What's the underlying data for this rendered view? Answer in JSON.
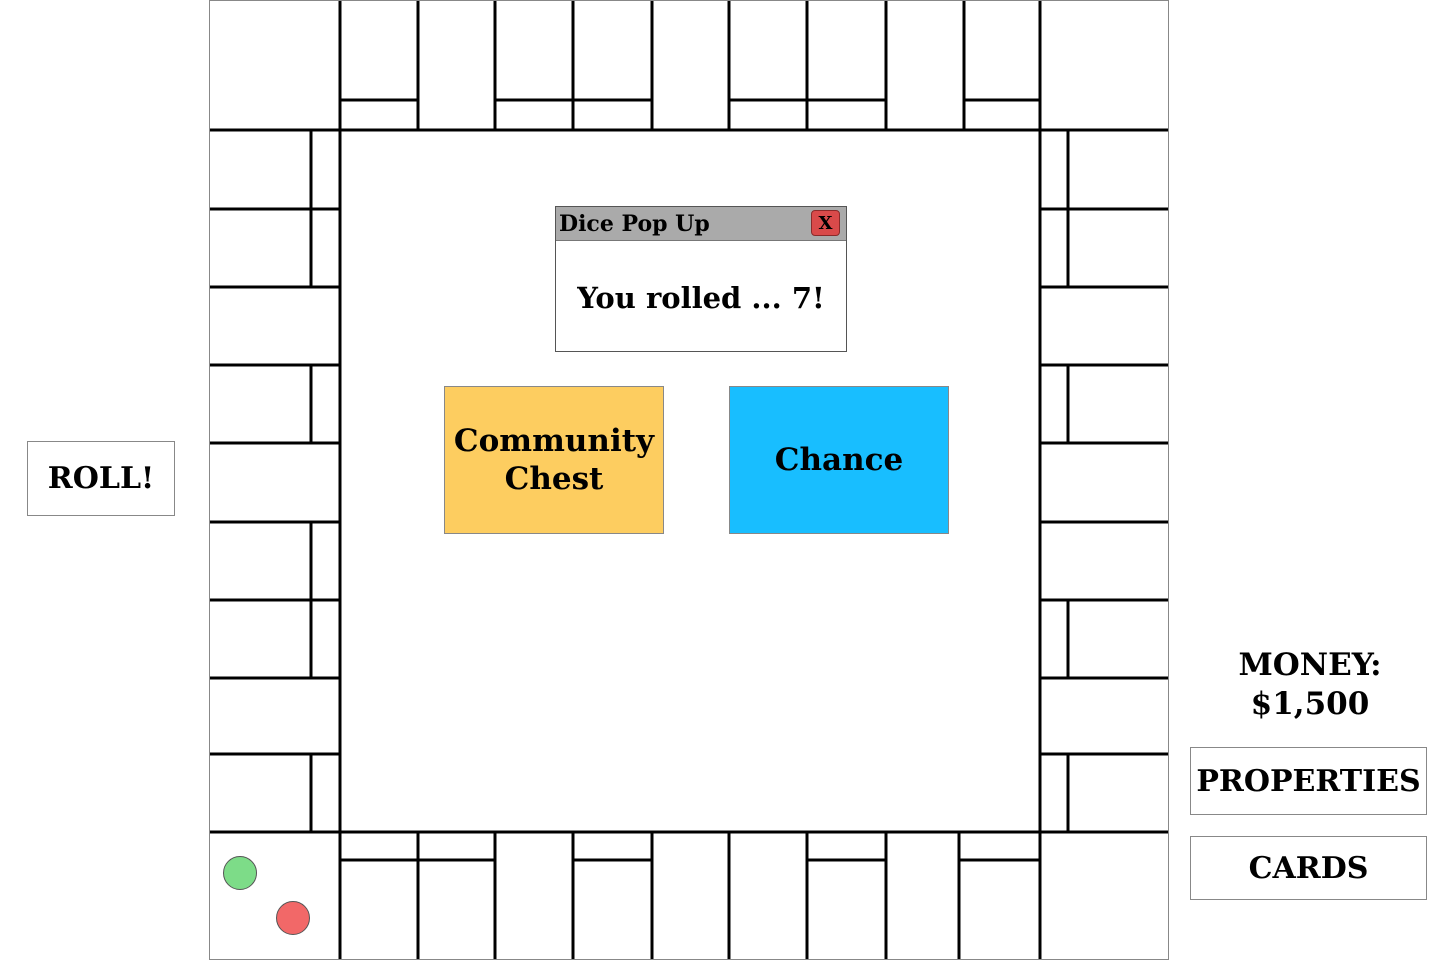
{
  "roll_button": {
    "label": "ROLL!"
  },
  "sidebar": {
    "money_label": "MONEY:",
    "money_value": "$1,500",
    "properties_label": "PROPERTIES",
    "cards_label": "CARDS"
  },
  "center": {
    "community_chest": {
      "line1": "Community",
      "line2": "Chest",
      "color": "#fdcd60"
    },
    "chance": {
      "label": "Chance",
      "color": "#18beff"
    }
  },
  "dice_popup": {
    "title": "Dice Pop Up",
    "close_label": "X",
    "message": "You rolled ... 7!"
  },
  "players": [
    {
      "name": "player-green",
      "color": "#7ddc88"
    },
    {
      "name": "player-red",
      "color": "#f26868"
    }
  ]
}
